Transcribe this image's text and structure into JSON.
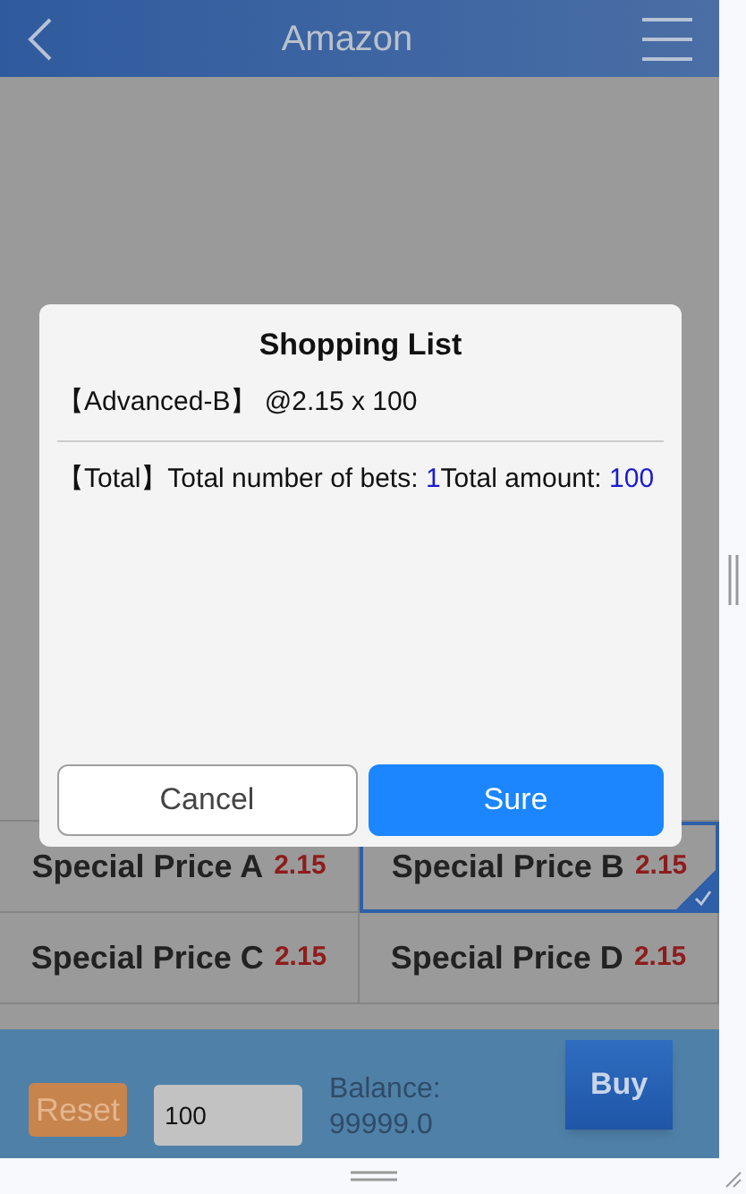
{
  "header": {
    "title": "Amazon"
  },
  "dialog": {
    "title": "Shopping List",
    "line": "【Advanced-B】 @2.15 x 100",
    "total": {
      "bets_label": "【Total】Total number of bets:",
      "bets": "1",
      "amount_label": "Total amount:",
      "amount": "100"
    },
    "buttons": [
      {
        "kind": "secondary",
        "label": "Cancel"
      },
      {
        "kind": "primary",
        "label": "Sure"
      }
    ]
  },
  "options": [
    {
      "name": "Special Price A",
      "odds": "2.15",
      "selected": false
    },
    {
      "name": "Special Price B",
      "odds": "2.15",
      "selected": true
    },
    {
      "name": "Special Price C",
      "odds": "2.15",
      "selected": false
    },
    {
      "name": "Special Price D",
      "odds": "2.15",
      "selected": false
    }
  ],
  "footer": {
    "reset": "Reset",
    "amount": "100",
    "balance_label": "Balance:",
    "balance": "99999.0",
    "buy": "Buy"
  }
}
